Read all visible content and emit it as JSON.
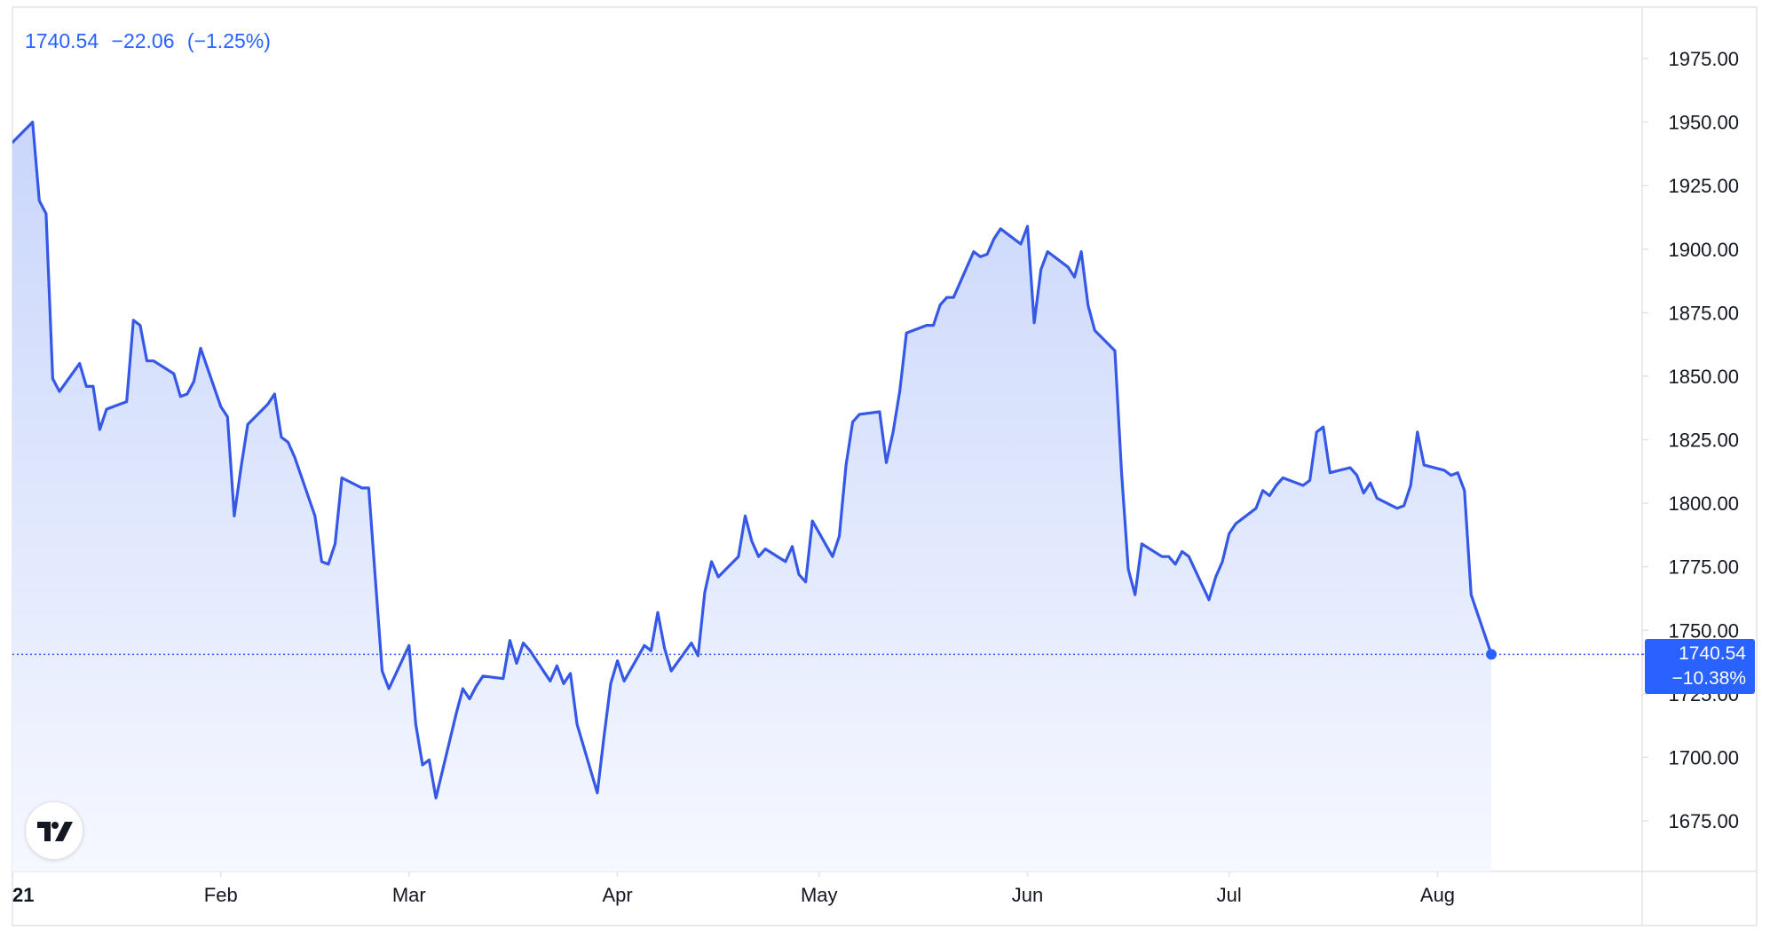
{
  "header": {
    "price": "1740.54",
    "change": "−22.06",
    "change_pct": "(−1.25%)"
  },
  "badge": {
    "price": "1740.54",
    "change_pct": "−10.38%"
  },
  "colors": {
    "line": "#3558e6",
    "accent": "#2962ff",
    "fill_top": "#c9d6fb",
    "fill_bottom": "#f6f8ff",
    "grid": "#e0e3eb",
    "text": "#131722"
  },
  "logo": {
    "icon": "tradingview-logo"
  },
  "chart_data": {
    "type": "area",
    "ylim": [
      1662,
      1997
    ],
    "y_ticks": [
      "1675.00",
      "1700.00",
      "1725.00",
      "1750.00",
      "1775.00",
      "1800.00",
      "1825.00",
      "1850.00",
      "1875.00",
      "1900.00",
      "1925.00",
      "1950.00",
      "1975.00"
    ],
    "x_ticks": [
      {
        "label": "21",
        "date": "2021-01-01"
      },
      {
        "label": "Feb",
        "date": "2021-02-01"
      },
      {
        "label": "Mar",
        "date": "2021-03-01"
      },
      {
        "label": "Apr",
        "date": "2021-04-01"
      },
      {
        "label": "May",
        "date": "2021-05-01"
      },
      {
        "label": "Jun",
        "date": "2021-06-01"
      },
      {
        "label": "Jul",
        "date": "2021-07-01"
      },
      {
        "label": "Aug",
        "date": "2021-08-01"
      }
    ],
    "xlim": [
      "2021-01-01",
      "2021-09-10"
    ],
    "last_value": 1740.54,
    "series": [
      {
        "x": [
          "2021-01-01",
          "2021-01-04",
          "2021-01-05",
          "2021-01-06",
          "2021-01-07",
          "2021-01-08",
          "2021-01-11",
          "2021-01-12",
          "2021-01-13",
          "2021-01-14",
          "2021-01-15",
          "2021-01-18",
          "2021-01-19",
          "2021-01-20",
          "2021-01-21",
          "2021-01-22",
          "2021-01-25",
          "2021-01-26",
          "2021-01-27",
          "2021-01-28",
          "2021-01-29",
          "2021-02-01",
          "2021-02-02",
          "2021-02-03",
          "2021-02-04",
          "2021-02-05",
          "2021-02-08",
          "2021-02-09",
          "2021-02-10",
          "2021-02-11",
          "2021-02-12",
          "2021-02-15",
          "2021-02-16",
          "2021-02-17",
          "2021-02-18",
          "2021-02-19",
          "2021-02-22",
          "2021-02-23",
          "2021-02-24",
          "2021-02-25",
          "2021-02-26",
          "2021-03-01",
          "2021-03-02",
          "2021-03-03",
          "2021-03-04",
          "2021-03-05",
          "2021-03-08",
          "2021-03-09",
          "2021-03-10",
          "2021-03-11",
          "2021-03-12",
          "2021-03-15",
          "2021-03-16",
          "2021-03-17",
          "2021-03-18",
          "2021-03-19",
          "2021-03-22",
          "2021-03-23",
          "2021-03-24",
          "2021-03-25",
          "2021-03-26",
          "2021-03-29",
          "2021-03-30",
          "2021-03-31",
          "2021-04-01",
          "2021-04-02",
          "2021-04-05",
          "2021-04-06",
          "2021-04-07",
          "2021-04-08",
          "2021-04-09",
          "2021-04-12",
          "2021-04-13",
          "2021-04-14",
          "2021-04-15",
          "2021-04-16",
          "2021-04-19",
          "2021-04-20",
          "2021-04-21",
          "2021-04-22",
          "2021-04-23",
          "2021-04-26",
          "2021-04-27",
          "2021-04-28",
          "2021-04-29",
          "2021-04-30",
          "2021-05-03",
          "2021-05-04",
          "2021-05-05",
          "2021-05-06",
          "2021-05-07",
          "2021-05-10",
          "2021-05-11",
          "2021-05-12",
          "2021-05-13",
          "2021-05-14",
          "2021-05-17",
          "2021-05-18",
          "2021-05-19",
          "2021-05-20",
          "2021-05-21",
          "2021-05-24",
          "2021-05-25",
          "2021-05-26",
          "2021-05-27",
          "2021-05-28",
          "2021-05-31",
          "2021-06-01",
          "2021-06-02",
          "2021-06-03",
          "2021-06-04",
          "2021-06-07",
          "2021-06-08",
          "2021-06-09",
          "2021-06-10",
          "2021-06-11",
          "2021-06-14",
          "2021-06-15",
          "2021-06-16",
          "2021-06-17",
          "2021-06-18",
          "2021-06-21",
          "2021-06-22",
          "2021-06-23",
          "2021-06-24",
          "2021-06-25",
          "2021-06-28",
          "2021-06-29",
          "2021-06-30",
          "2021-07-01",
          "2021-07-02",
          "2021-07-05",
          "2021-07-06",
          "2021-07-07",
          "2021-07-08",
          "2021-07-09",
          "2021-07-12",
          "2021-07-13",
          "2021-07-14",
          "2021-07-15",
          "2021-07-16",
          "2021-07-19",
          "2021-07-20",
          "2021-07-21",
          "2021-07-22",
          "2021-07-23",
          "2021-07-26",
          "2021-07-27",
          "2021-07-28",
          "2021-07-29",
          "2021-07-30",
          "2021-08-02",
          "2021-08-03",
          "2021-08-04",
          "2021-08-05",
          "2021-08-06",
          "2021-08-09"
        ],
        "y": [
          1942,
          1950,
          1919,
          1914,
          1849,
          1844,
          1855,
          1846,
          1846,
          1829,
          1837,
          1840,
          1872,
          1870,
          1856,
          1856,
          1851,
          1842,
          1843,
          1848,
          1861,
          1838,
          1834,
          1795,
          1814,
          1831,
          1839,
          1843,
          1826,
          1824,
          1818,
          1795,
          1777,
          1776,
          1784,
          1810,
          1806,
          1806,
          1770,
          1734,
          1727,
          1744,
          1713,
          1697,
          1699,
          1684,
          1717,
          1727,
          1723,
          1728,
          1732,
          1731,
          1746,
          1737,
          1745,
          1742,
          1730,
          1736,
          1729,
          1733,
          1713,
          1686,
          1708,
          1729,
          1738,
          1730,
          1744,
          1742,
          1757,
          1743,
          1734,
          1745,
          1740,
          1765,
          1777,
          1771,
          1779,
          1795,
          1785,
          1779,
          1782,
          1777,
          1783,
          1772,
          1769,
          1793,
          1779,
          1787,
          1815,
          1832,
          1835,
          1836,
          1816,
          1828,
          1844,
          1867,
          1870,
          1870,
          1878,
          1881,
          1881,
          1899,
          1897,
          1898,
          1904,
          1908,
          1902,
          1909,
          1871,
          1892,
          1899,
          1893,
          1889,
          1899,
          1878,
          1868,
          1860,
          1812,
          1774,
          1764,
          1784,
          1779,
          1779,
          1776,
          1781,
          1779,
          1762,
          1771,
          1777,
          1788,
          1792,
          1798,
          1805,
          1803,
          1807,
          1810,
          1807,
          1809,
          1828,
          1830,
          1812,
          1814,
          1811,
          1804,
          1808,
          1802,
          1798,
          1799,
          1807,
          1828,
          1815,
          1813,
          1811,
          1812,
          1805,
          1764,
          1740.54
        ]
      }
    ]
  }
}
